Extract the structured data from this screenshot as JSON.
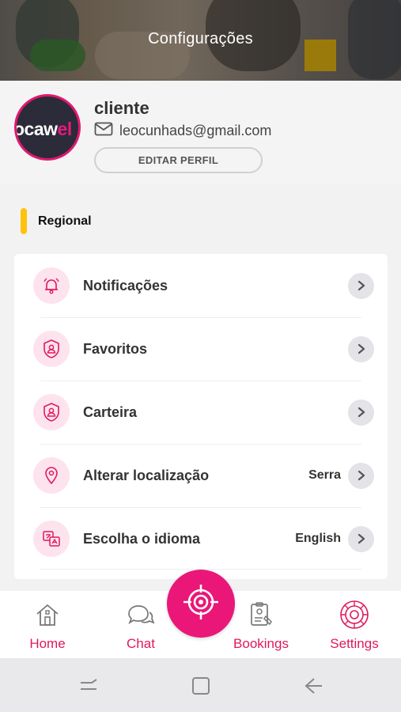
{
  "header": {
    "title": "Configurações"
  },
  "profile": {
    "avatar_brand_white": "ocaw",
    "avatar_brand_pink": "el",
    "name": "cliente",
    "email": "leocunhads@gmail.com",
    "edit_label": "EDITAR PERFIL"
  },
  "section": {
    "label": "Regional",
    "accent_color": "#ffc20e"
  },
  "menu": [
    {
      "label": "Notificações",
      "value": "",
      "icon": "bell-icon"
    },
    {
      "label": "Favoritos",
      "value": "",
      "icon": "shield-user-icon"
    },
    {
      "label": "Carteira",
      "value": "",
      "icon": "shield-user-icon"
    },
    {
      "label": "Alterar localização",
      "value": "Serra",
      "icon": "location-pin-icon"
    },
    {
      "label": "Escolha o idioma",
      "value": "English",
      "icon": "translate-icon"
    }
  ],
  "nav": [
    {
      "label": "Home",
      "icon": "home-icon"
    },
    {
      "label": "Chat",
      "icon": "chat-icon"
    },
    {
      "label": "Bookings",
      "icon": "bookings-icon"
    },
    {
      "label": "Settings",
      "icon": "settings-icon"
    }
  ],
  "fab": {
    "icon": "target-icon"
  },
  "colors": {
    "accent": "#e0195a",
    "fab": "#ea1778",
    "icon_bg": "#fde3ee"
  }
}
